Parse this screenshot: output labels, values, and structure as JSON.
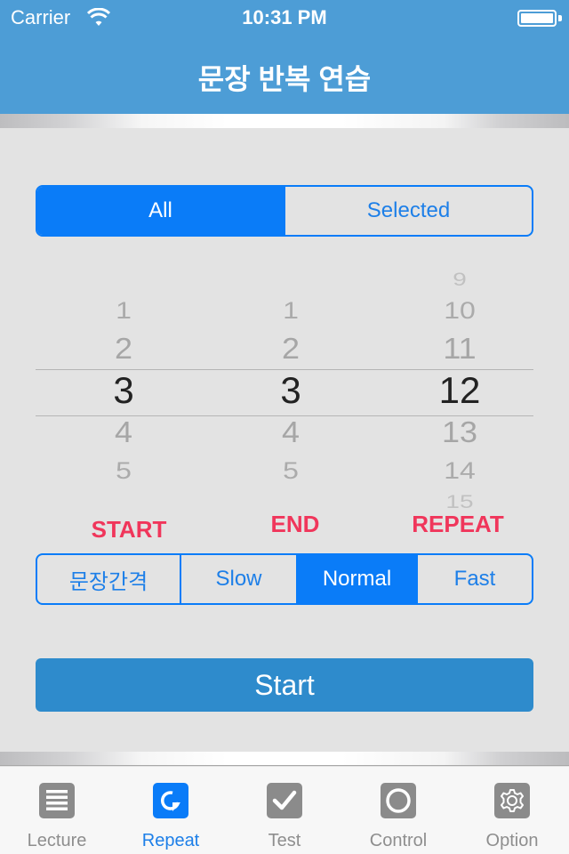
{
  "status_bar": {
    "carrier": "Carrier",
    "time": "10:31 PM",
    "battery_level": 1.0
  },
  "header": {
    "title": "문장 반복 연습"
  },
  "scope_segment": {
    "items": [
      {
        "label": "All",
        "selected": true
      },
      {
        "label": "Selected",
        "selected": false
      }
    ]
  },
  "picker": {
    "columns": [
      {
        "name": "start",
        "visible": [
          "1",
          "2",
          "3",
          "4",
          "5"
        ],
        "selected": "3",
        "label": "START"
      },
      {
        "name": "end",
        "visible": [
          "1",
          "2",
          "3",
          "4",
          "5"
        ],
        "selected": "3",
        "label": "END"
      },
      {
        "name": "repeat",
        "visible": [
          "9",
          "10",
          "11",
          "12",
          "13",
          "14",
          "15"
        ],
        "selected": "12",
        "label": "REPEAT"
      }
    ]
  },
  "speed_segment": {
    "items": [
      {
        "label": "문장간격",
        "selected": false
      },
      {
        "label": "Slow",
        "selected": false
      },
      {
        "label": "Normal",
        "selected": true
      },
      {
        "label": "Fast",
        "selected": false
      }
    ]
  },
  "start_button": {
    "label": "Start"
  },
  "tabbar": {
    "items": [
      {
        "label": "Lecture",
        "icon": "list-icon",
        "active": false
      },
      {
        "label": "Repeat",
        "icon": "repeat-icon",
        "active": true
      },
      {
        "label": "Test",
        "icon": "checkmark-icon",
        "active": false
      },
      {
        "label": "Control",
        "icon": "circle-icon",
        "active": false
      },
      {
        "label": "Option",
        "icon": "gear-icon",
        "active": false
      }
    ]
  },
  "colors": {
    "accent": "#0a7cf8",
    "header": "#4d9dd6",
    "label_red": "#f0365b",
    "start_button": "#2e8bcc"
  }
}
